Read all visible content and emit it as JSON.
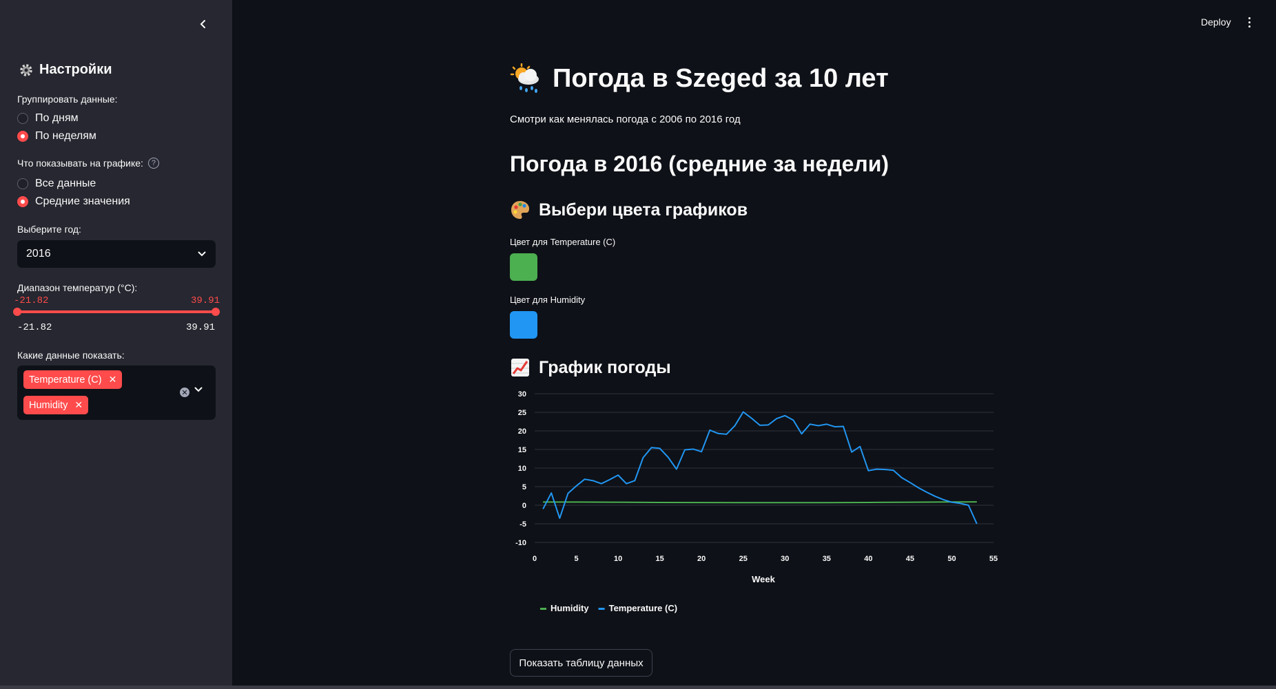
{
  "header": {
    "deploy_label": "Deploy"
  },
  "sidebar": {
    "title": "Настройки",
    "group_label": "Группировать данные:",
    "group_options": [
      {
        "label": "По дням",
        "selected": false
      },
      {
        "label": "По неделям",
        "selected": true
      }
    ],
    "show_label": "Что показывать на графике:",
    "show_options": [
      {
        "label": "Все данные",
        "selected": false
      },
      {
        "label": "Средние значения",
        "selected": true
      }
    ],
    "year_label": "Выберите год:",
    "year_value": "2016",
    "temp_range_label": "Диапазон температур (°C):",
    "temp_range": {
      "min": "-21.82",
      "max": "39.91",
      "min_label": "-21.82",
      "max_label": "39.91"
    },
    "data_label": "Какие данные показать:",
    "data_tags": [
      "Temperature (C)",
      "Humidity"
    ]
  },
  "main": {
    "title": "Погода в Szeged за 10 лет",
    "subtitle": "Смотри как менялась погода с 2006 по 2016 год",
    "section_title": "Погода в 2016 (средние за недели)",
    "colors_header": "Выбери цвета графиков",
    "temp_color_label": "Цвет для Temperature (C)",
    "temp_color": "#4caf50",
    "hum_color_label": "Цвет для Humidity",
    "hum_color": "#2196f3",
    "chart_header": "График погоды",
    "table_button": "Показать таблицу данных"
  },
  "chart_data": {
    "type": "line",
    "xlabel": "Week",
    "ylabel": "",
    "xlim": [
      0,
      55
    ],
    "ylim": [
      -10,
      30
    ],
    "xticks": [
      0,
      5,
      10,
      15,
      20,
      25,
      30,
      35,
      40,
      45,
      50,
      55
    ],
    "yticks": [
      30,
      25,
      20,
      15,
      10,
      5,
      0,
      -5,
      -10
    ],
    "legend_position": "bottom-left",
    "series": [
      {
        "name": "Humidity",
        "color": "#4caf50",
        "x": [
          1,
          5,
          10,
          15,
          20,
          25,
          30,
          35,
          40,
          45,
          50,
          53
        ],
        "values": [
          0.85,
          0.86,
          0.8,
          0.75,
          0.72,
          0.7,
          0.69,
          0.7,
          0.75,
          0.82,
          0.88,
          0.9
        ]
      },
      {
        "name": "Temperature (C)",
        "color": "#2196f3",
        "x": [
          1,
          2,
          3,
          4,
          5,
          6,
          7,
          8,
          9,
          10,
          11,
          12,
          13,
          14,
          15,
          16,
          17,
          18,
          19,
          20,
          21,
          22,
          23,
          24,
          25,
          26,
          27,
          28,
          29,
          30,
          31,
          32,
          33,
          34,
          35,
          36,
          37,
          38,
          39,
          40,
          41,
          42,
          43,
          44,
          45,
          46,
          47,
          48,
          49,
          50,
          51,
          52,
          53
        ],
        "values": [
          -1,
          3.3,
          -3.5,
          3.2,
          5.2,
          7,
          6.6,
          5.8,
          6.9,
          8.1,
          5.8,
          6.6,
          12.8,
          15.5,
          15.3,
          12.9,
          9.7,
          14.9,
          15.1,
          14.4,
          20.2,
          19.3,
          19.1,
          21.4,
          25.1,
          23.4,
          21.5,
          21.6,
          23.3,
          24.1,
          22.9,
          19.2,
          21.8,
          21.4,
          21.8,
          21.1,
          21.2,
          14.3,
          15.8,
          9.3,
          9.7,
          9.6,
          9.4,
          7.4,
          6.1,
          4.7,
          3.5,
          2.4,
          1.5,
          0.8,
          0.5,
          0.0,
          -5
        ]
      }
    ]
  }
}
